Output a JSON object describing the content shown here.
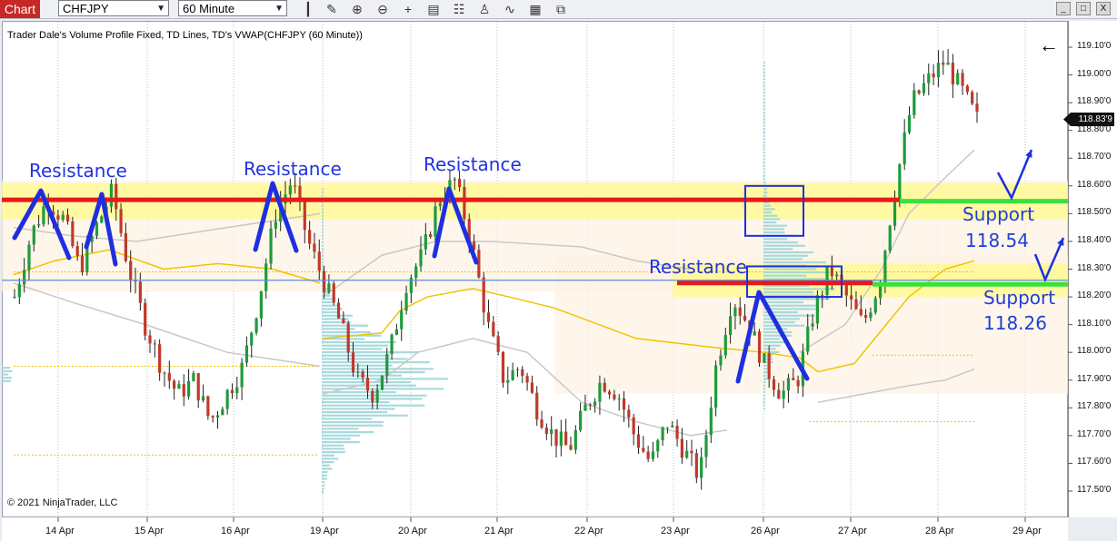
{
  "toolbar": {
    "chart_tab": "Chart",
    "instrument": "CHFJPY",
    "interval": "60 Minute",
    "icons": [
      "bar-type-icon",
      "draw-pencil-icon",
      "zoom-in-icon",
      "zoom-out-icon",
      "crosshair-icon",
      "data-box-icon",
      "properties-icon",
      "strategies-icon",
      "indicators-icon",
      "templates-icon",
      "share-icon"
    ]
  },
  "window": {
    "min": "_",
    "max": "□",
    "close": "X"
  },
  "chart": {
    "title": "Trader Dale's Volume Profile Fixed, TD Lines, TD's VWAP(CHFJPY (60 Minute))",
    "copyright": "© 2021 NinjaTrader, LLC",
    "back_arrow": "←",
    "current_price": "118.83'9",
    "price_ticks": [
      "119.10'0",
      "119.00'0",
      "118.90'0",
      "118.80'0",
      "118.70'0",
      "118.60'0",
      "118.50'0",
      "118.40'0",
      "118.30'0",
      "118.20'0",
      "118.10'0",
      "118.00'0",
      "117.90'0",
      "117.80'0",
      "117.70'0",
      "117.60'0",
      "117.50'0"
    ],
    "date_ticks": [
      "14 Apr",
      "15 Apr",
      "16 Apr",
      "19 Apr",
      "20 Apr",
      "21 Apr",
      "22 Apr",
      "23 Apr",
      "26 Apr",
      "27 Apr",
      "28 Apr",
      "29 Apr"
    ],
    "annotations": {
      "resistance1": "Resistance",
      "resistance2": "Resistance",
      "resistance3": "Resistance",
      "resistance4": "Resistance",
      "support1": "Support",
      "support1_value": "118.54",
      "support2": "Support",
      "support2_value": "118.26"
    },
    "colors": {
      "up_candle": "#1e9b3c",
      "down_candle": "#c0392b",
      "level_red": "#e31b1b",
      "level_green": "#39e03c",
      "zone_yellow": "#fffb6a",
      "annotation_blue": "#1f2fe0",
      "volume_profile": "#9fd5d8",
      "vwap": "#f2c200",
      "band": "#c8c8c8"
    }
  },
  "chart_data": {
    "type": "candlestick",
    "ylim": [
      117.45,
      119.17
    ],
    "x_categories": [
      "14 Apr",
      "15 Apr",
      "16 Apr",
      "19 Apr",
      "20 Apr",
      "21 Apr",
      "22 Apr",
      "23 Apr",
      "26 Apr",
      "27 Apr",
      "28 Apr",
      "29 Apr"
    ],
    "levels": [
      {
        "price": 118.54,
        "label": "Support 118.54"
      },
      {
        "price": 118.26,
        "label": "Support 118.26"
      }
    ],
    "close_path": [
      118.2,
      118.42,
      118.55,
      118.48,
      118.3,
      118.45,
      118.58,
      118.3,
      118.1,
      117.95,
      117.85,
      117.9,
      117.75,
      117.85,
      117.95,
      118.2,
      118.5,
      118.62,
      118.4,
      118.25,
      118.1,
      117.9,
      117.85,
      118.0,
      118.25,
      118.35,
      118.55,
      118.62,
      118.4,
      118.1,
      117.9,
      117.95,
      117.8,
      117.7,
      117.65,
      117.8,
      117.9,
      117.85,
      117.7,
      117.6,
      117.75,
      117.65,
      117.55,
      117.95,
      118.2,
      118.1,
      117.95,
      117.85,
      117.9,
      118.15,
      118.3,
      118.2,
      118.1,
      118.25,
      118.6,
      118.9,
      118.98,
      119.05,
      118.95,
      118.84
    ]
  }
}
